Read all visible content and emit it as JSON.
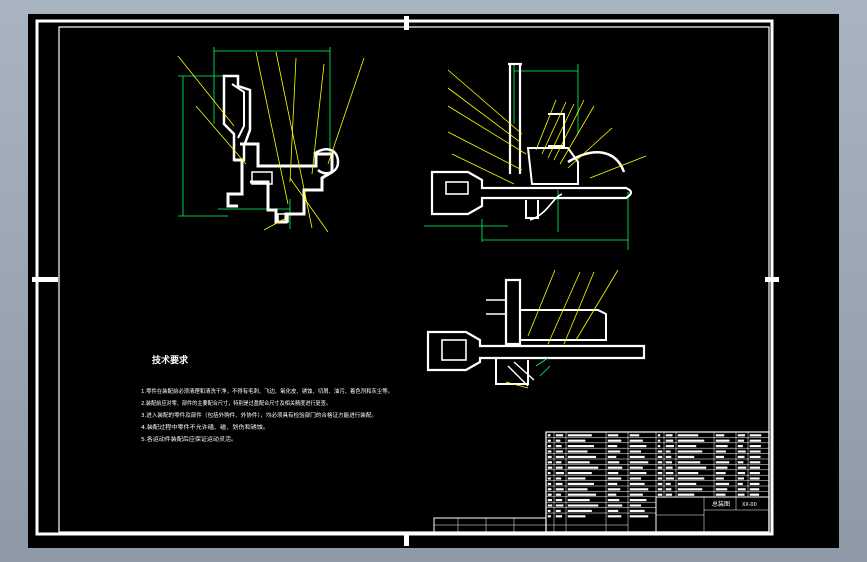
{
  "drawing": {
    "background": "#000000",
    "line_color": "#ffffff",
    "dimension_color": "#00ff66",
    "leader_color": "#ffff00"
  },
  "technical_requirements": {
    "title": "技术要求",
    "items": [
      "1.零件在装配前必须清理和清洗干净，不得有毛刺、飞边、氧化皮、锈蚀、切屑、油污、着色剂和灰尘等。",
      "2.装配前应对零、部件的主要配合尺寸，特别是过盈配合尺寸及相关精度进行复查。",
      "3.进入装配的零件及部件（包括外购件、外协件），均必须具有检验部门的合格证方能进行装配。",
      "4.装配过程中零件不允许磕、碰、划伤和锈蚀。",
      "5.各运动件装配后应保证运动灵活。"
    ]
  },
  "title_block": {
    "drawing_name": "总装图",
    "part_code": "XX-00"
  }
}
